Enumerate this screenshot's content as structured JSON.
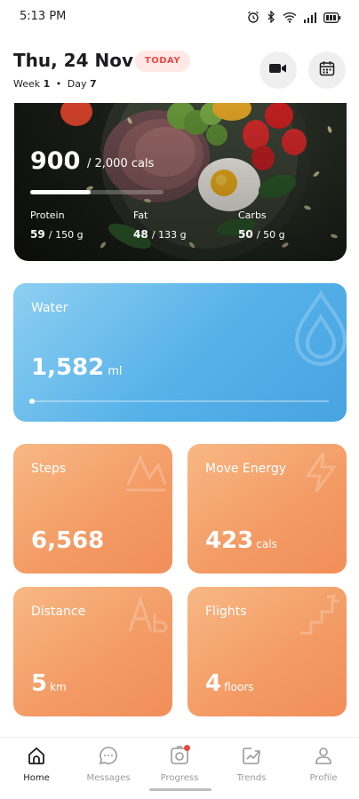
{
  "status_bar": {
    "time": "5:13 PM"
  },
  "header": {
    "date": "Thu, 24 Nov",
    "today_badge": "TODAY",
    "week_label": "Week",
    "week_num": "1",
    "separator": "•",
    "day_label": "Day",
    "day_num": "7"
  },
  "nutrition": {
    "calories": "900",
    "calories_goal": "/ 2,000 cals",
    "progress": 0.45,
    "macros": [
      {
        "label": "Protein",
        "value": "59",
        "goal": "/ 150 g"
      },
      {
        "label": "Fat",
        "value": "48",
        "goal": "/ 133 g"
      },
      {
        "label": "Carbs",
        "value": "50",
        "goal": "/ 50 g"
      }
    ]
  },
  "water": {
    "title": "Water",
    "value": "1,582",
    "unit": "ml",
    "progress": 0.0
  },
  "tiles": {
    "steps": {
      "title": "Steps",
      "value": "6,568",
      "unit": ""
    },
    "move_energy": {
      "title": "Move Energy",
      "value": "423",
      "unit": "cals"
    },
    "distance": {
      "title": "Distance",
      "value": "5",
      "unit": "km"
    },
    "flights": {
      "title": "Flights",
      "value": "4",
      "unit": "floors"
    }
  },
  "nav": {
    "items": [
      {
        "label": "Home",
        "icon": "home-icon",
        "active": true
      },
      {
        "label": "Messages",
        "icon": "chat-icon",
        "active": false
      },
      {
        "label": "Progress",
        "icon": "camera-icon",
        "active": false
      },
      {
        "label": "Trends",
        "icon": "trend-icon",
        "active": false
      },
      {
        "label": "Profile",
        "icon": "user-icon",
        "active": false
      }
    ]
  },
  "colors": {
    "accent_red": "#ec4b45",
    "water_blue": "#55b1e8",
    "tile_orange": "#f39a64"
  }
}
